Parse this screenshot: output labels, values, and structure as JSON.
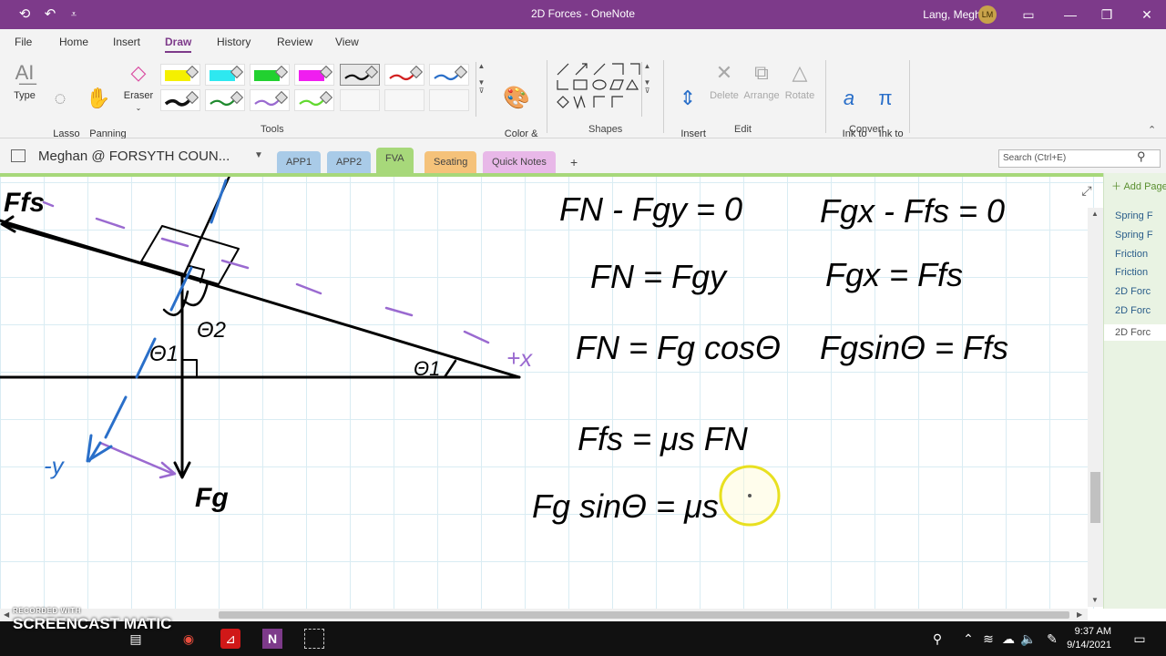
{
  "window": {
    "title": "2D Forces - OneNote",
    "user_name": "Lang, Meghan",
    "user_initials": "LM"
  },
  "menu": {
    "tabs": [
      "File",
      "Home",
      "Insert",
      "Draw",
      "History",
      "Review",
      "View"
    ],
    "active": "Draw"
  },
  "ribbon": {
    "tools": {
      "type_label": "Type",
      "lasso_label": "Lasso\nSelect",
      "panning_label": "Panning\nHand",
      "eraser_label": "Eraser",
      "color_label": "Color &\nThickness",
      "group_label": "Tools"
    },
    "pens": [
      {
        "color": "#f5f000",
        "kind": "highlighter"
      },
      {
        "color": "#2ee8f0",
        "kind": "highlighter"
      },
      {
        "color": "#22d130",
        "kind": "highlighter"
      },
      {
        "color": "#f01ef0",
        "kind": "highlighter"
      },
      {
        "color": "#111111",
        "kind": "pen"
      },
      {
        "color": "#d22020",
        "kind": "pen"
      },
      {
        "color": "#2a6fc9",
        "kind": "pen"
      },
      {
        "color": "#111111",
        "kind": "pen-thick"
      },
      {
        "color": "#1f8a2e",
        "kind": "pen"
      },
      {
        "color": "#9a6ad0",
        "kind": "pen"
      },
      {
        "color": "#62d930",
        "kind": "pen"
      }
    ],
    "shapes_group_label": "Shapes",
    "edit": {
      "insert_space_label": "Insert\nSpace",
      "delete_label": "Delete",
      "arrange_label": "Arrange",
      "rotate_label": "Rotate",
      "group_label": "Edit"
    },
    "convert": {
      "ink_to_text_label": "Ink to\nText",
      "ink_to_math_label": "Ink to\nMath",
      "group_label": "Convert"
    }
  },
  "notebook": {
    "name": "Meghan @ FORSYTH COUN...",
    "sections": [
      {
        "label": "APP1",
        "color": "#a9cbe8"
      },
      {
        "label": "APP2",
        "color": "#a9cbe8"
      },
      {
        "label": "FVA",
        "color": "#a7d87a",
        "active": true
      },
      {
        "label": "Seating",
        "color": "#f5c27a"
      },
      {
        "label": "Quick Notes",
        "color": "#e8b8e8"
      }
    ],
    "add_section": "+",
    "search_placeholder": "Search (Ctrl+E)"
  },
  "pages": {
    "add_label": "Add Page",
    "items": [
      "Spring F",
      "Spring F",
      "Friction",
      "Friction",
      "2D Forc",
      "2D Forc",
      "2D Forc"
    ],
    "selected_index": 6
  },
  "ink": {
    "diagram_labels": {
      "ffs": "Ffs",
      "theta2": "Θ2",
      "theta1_left": "Θ1",
      "theta1_right": "Θ1",
      "plus_x": "+x",
      "minus_y": "-y",
      "fg": "Fg"
    },
    "equations": [
      "FN - Fgy = 0",
      "FN = Fgy",
      "FN = Fg cosΘ",
      "Ffs = μs FN",
      "Fg sinΘ = μs",
      "Fgx - Ffs = 0",
      "Fgx = Ffs",
      "FgsinΘ = Ffs"
    ]
  },
  "taskbar": {
    "watermark_small": "RECORDED WITH",
    "watermark_big": "SCREENCAST MATIC",
    "time": "9:37 AM",
    "date": "9/14/2021"
  }
}
